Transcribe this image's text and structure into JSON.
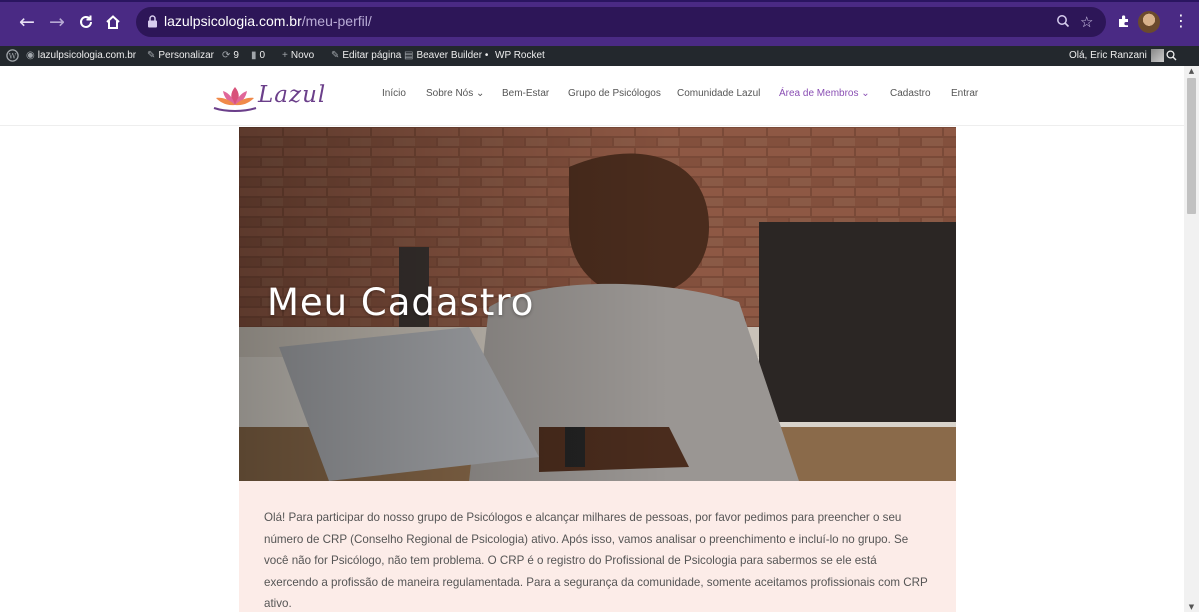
{
  "browser": {
    "url_host": "lazulpsicologia.com.br",
    "url_path": "/meu-perfil/",
    "icons": [
      "back-icon",
      "forward-icon",
      "reload-icon",
      "home-icon",
      "lock-icon",
      "zoom-icon",
      "star-icon",
      "extensions-icon",
      "menu-icon"
    ]
  },
  "admin_bar": {
    "site": "lazulpsicologia.com.br",
    "customize": "Personalizar",
    "updates": "9",
    "comments": "0",
    "new": "Novo",
    "edit": "Editar página",
    "beaver": "Beaver Builder",
    "beaver_dot": "•",
    "rocket": "WP Rocket",
    "greeting": "Olá, Eric Ranzani"
  },
  "header": {
    "logo_text": "Lazul",
    "menu": [
      {
        "label": "Início"
      },
      {
        "label": "Sobre Nós"
      },
      {
        "label": "Bem-Estar"
      },
      {
        "label": "Grupo de Psicólogos"
      },
      {
        "label": "Comunidade Lazul"
      },
      {
        "label": "Área de Membros"
      },
      {
        "label": "Cadastro"
      },
      {
        "label": "Entrar"
      }
    ]
  },
  "hero": {
    "title": "Meu Cadastro"
  },
  "intro": {
    "text": "Olá! Para participar do nosso grupo de Psicólogos e alcançar milhares de pessoas, por favor pedimos para preencher o seu número de CRP (Conselho Regional de Psicologia) ativo. Após isso, vamos analisar o preenchimento e incluí-lo no grupo. Se você não for Psicólogo, não tem problema. O CRP é o registro do Profissional de Psicologia para sabermos se ele está exercendo a profissão de maneira regulamentada. Para a segurança da comunidade, somente aceitamos profissionais com CRP ativo."
  },
  "colors": {
    "browser_chrome": "#4a2a84",
    "omnibox": "#2d1658",
    "admin_bar": "#23282d",
    "menu_active": "#8a4fb4",
    "intro_background": "#fcece8",
    "logo": "#6b3f8a"
  }
}
